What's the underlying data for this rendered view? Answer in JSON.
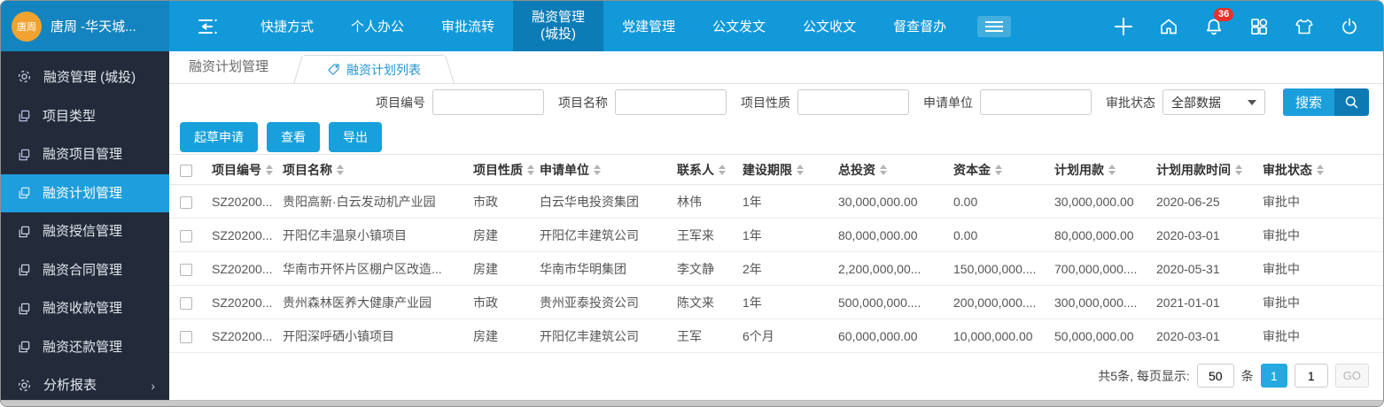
{
  "colors": {
    "navbar": "#1199da",
    "navbar_active": "#0c7cb7",
    "user_block": "#1384bf",
    "sidebar": "#232b3a",
    "sidebar_active": "#1e9edd",
    "accent": "#18a0dc",
    "search_dark": "#0d7ab3",
    "badge_red": "#e8302a",
    "avatar_orange": "#f0a32f",
    "page_active": "#25a9e0"
  },
  "topbar": {
    "user": {
      "avatar_text": "唐周",
      "name": "唐周 -华天城..."
    },
    "nav": [
      {
        "label": "快捷方式"
      },
      {
        "label": "个人办公"
      },
      {
        "label": "审批流转"
      },
      {
        "line1": "融资管理",
        "line2": "(城投)",
        "active": true
      },
      {
        "label": "党建管理"
      },
      {
        "label": "公文发文"
      },
      {
        "label": "公文收文"
      },
      {
        "label": "督查督办"
      }
    ],
    "notification_count": "36",
    "icons": [
      "collapse-menu",
      "more-menu",
      "plus",
      "home",
      "bell",
      "apps-grid",
      "shirt",
      "power"
    ]
  },
  "sidebar": {
    "items": [
      {
        "label": "融资管理 (城投)",
        "icon": "gear"
      },
      {
        "label": "项目类型",
        "icon": "copy"
      },
      {
        "label": "融资项目管理",
        "icon": "copy"
      },
      {
        "label": "融资计划管理",
        "icon": "copy",
        "active": true
      },
      {
        "label": "融资授信管理",
        "icon": "copy"
      },
      {
        "label": "融资合同管理",
        "icon": "copy"
      },
      {
        "label": "融资收款管理",
        "icon": "copy"
      },
      {
        "label": "融资还款管理",
        "icon": "copy"
      },
      {
        "label": "分析报表",
        "icon": "gear",
        "chevron": "›"
      }
    ]
  },
  "tabs": {
    "module_title": "融资计划管理",
    "active_tab": "融资计划列表",
    "tab_icon": "tag"
  },
  "filters": {
    "fields": [
      {
        "label": "项目编号",
        "value": ""
      },
      {
        "label": "项目名称",
        "value": ""
      },
      {
        "label": "项目性质",
        "value": ""
      },
      {
        "label": "申请单位",
        "value": ""
      }
    ],
    "status": {
      "label": "审批状态",
      "value": "全部数据"
    },
    "search_label": "搜索"
  },
  "toolbar": {
    "buttons": [
      "起草申请",
      "查看",
      "导出"
    ]
  },
  "table": {
    "headers": [
      "项目编号",
      "项目名称",
      "项目性质",
      "申请单位",
      "联系人",
      "建设期限",
      "总投资",
      "资本金",
      "计划用款",
      "计划用款时间",
      "审批状态"
    ],
    "rows": [
      [
        "SZ20200...",
        "贵阳高新·白云发动机产业园",
        "市政",
        "白云华电投资集团",
        "林伟",
        "1年",
        "30,000,000.00",
        "0.00",
        "30,000,000.00",
        "2020-06-25",
        "审批中"
      ],
      [
        "SZ20200...",
        "开阳亿丰温泉小镇项目",
        "房建",
        "开阳亿丰建筑公司",
        "王军来",
        "1年",
        "80,000,000.00",
        "0.00",
        "80,000,000.00",
        "2020-03-01",
        "审批中"
      ],
      [
        "SZ20200...",
        "华南市开怀片区棚户区改造...",
        "房建",
        "华南市华明集团",
        "李文静",
        "2年",
        "2,200,000,00...",
        "150,000,000....",
        "700,000,000....",
        "2020-05-31",
        "审批中"
      ],
      [
        "SZ20200...",
        "贵州森林医养大健康产业园",
        "市政",
        "贵州亚泰投资公司",
        "陈文来",
        "1年",
        "500,000,000....",
        "200,000,000....",
        "300,000,000....",
        "2021-01-01",
        "审批中"
      ],
      [
        "SZ20200...",
        "开阳深呼硒小镇项目",
        "房建",
        "开阳亿丰建筑公司",
        "王军",
        "6个月",
        "60,000,000.00",
        "10,000,000.00",
        "50,000,000.00",
        "2020-03-01",
        "审批中"
      ]
    ]
  },
  "pagination": {
    "summary": "共5条, 每页显示:",
    "page_size": "50",
    "unit": "条",
    "current_page": "1",
    "goto_value": "1",
    "go_label": "GO"
  }
}
